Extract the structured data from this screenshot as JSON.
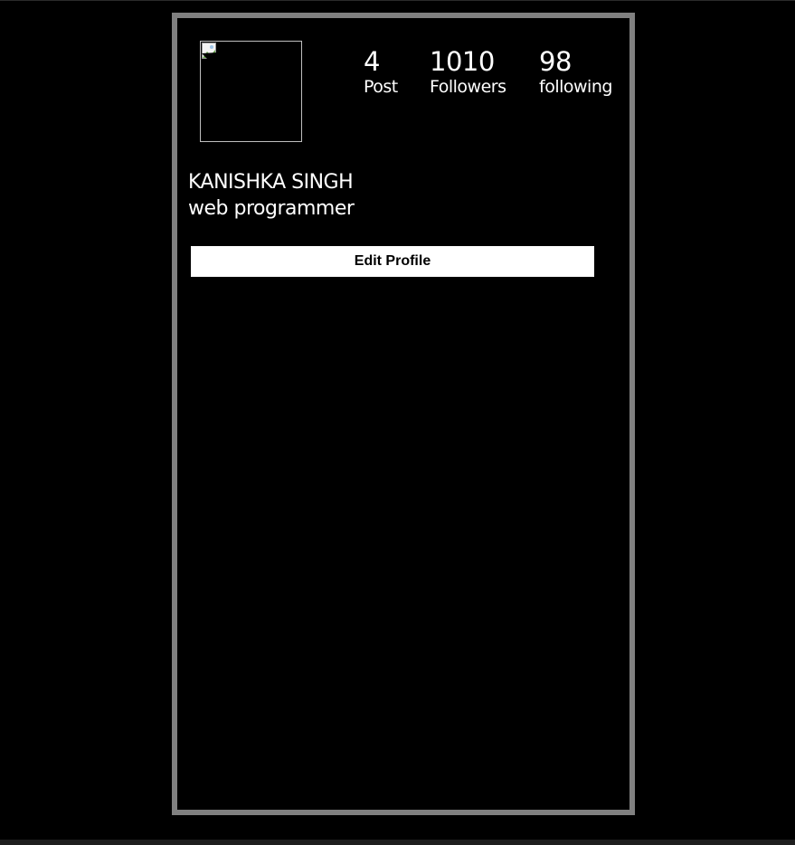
{
  "profile": {
    "name": "KANISHKA SINGH",
    "bio": "web programmer",
    "avatar_icon": "broken-image-icon"
  },
  "stats": {
    "posts": {
      "value": "4",
      "label": "Post"
    },
    "followers": {
      "value": "1010",
      "label": "Followers"
    },
    "following": {
      "value": "98",
      "label": "following"
    }
  },
  "actions": {
    "edit_profile_label": "Edit Profile"
  },
  "colors": {
    "background": "#000000",
    "card_border": "#808080",
    "text": "#ffffff",
    "button_bg": "#ffffff",
    "button_text": "#000000"
  }
}
